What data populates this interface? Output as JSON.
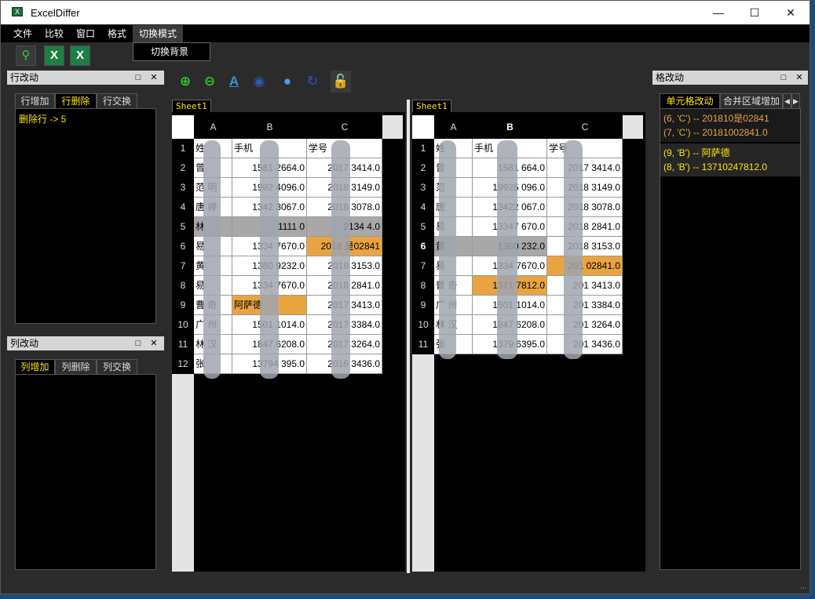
{
  "window": {
    "title": "ExcelDiffer"
  },
  "menu": {
    "items": [
      "文件",
      "比较",
      "窗口",
      "格式",
      "切换模式"
    ],
    "active": "切换模式",
    "dropdown_item": "切换背景"
  },
  "toolbar_main": [
    {
      "icon": "search-green-icon",
      "color": "#33cc33"
    },
    {
      "icon": "excel-file-icon",
      "color": "#1d7f44"
    },
    {
      "icon": "excel-file-icon",
      "color": "#1d7f44"
    }
  ],
  "toolbar_view": [
    {
      "icon": "zoom-in-icon",
      "color": "#2ecc2e"
    },
    {
      "icon": "zoom-out-icon",
      "color": "#2ecc2e"
    },
    {
      "icon": "font-color-icon",
      "color": "#3a8fe0"
    },
    {
      "icon": "fill-color-icon",
      "color": "#2a5ca8"
    },
    {
      "icon": "palette-icon",
      "color": "#4aa0e8"
    },
    {
      "icon": "refresh-icon",
      "color": "#2a4aa8"
    },
    {
      "icon": "unlock-icon",
      "color": "#f0a020"
    }
  ],
  "row_panel": {
    "title": "行改动",
    "tabs": [
      "行增加",
      "行删除",
      "行交换"
    ],
    "selected_tab": 1,
    "items": [
      "删除行 -> 5"
    ]
  },
  "col_panel": {
    "title": "列改动",
    "tabs": [
      "列增加",
      "列删除",
      "列交换"
    ],
    "selected_tab": 0,
    "items": []
  },
  "cell_panel": {
    "title": "格改动",
    "tabs": [
      "单元格改动",
      "合并区域增加"
    ],
    "selected_tab": 0,
    "groups": [
      {
        "color": "#e9a441",
        "items": [
          "(6, 'C') -- 201810是02841",
          "(7, 'C') -- 20181002841.0"
        ]
      },
      {
        "color": "#ffe600",
        "items": [
          "(9, 'B') -- 阿萨德",
          "(8, 'B') -- 13710247812.0"
        ]
      }
    ]
  },
  "left_sheet": {
    "tab": "Sheet1",
    "columns": [
      "A",
      "B",
      "C"
    ],
    "rows": [
      {
        "n": "1",
        "cells": [
          "姓",
          "手机",
          "学号"
        ],
        "styles": [
          "",
          "",
          ""
        ]
      },
      {
        "n": "2",
        "cells": [
          "曾",
          "1581 2664.0",
          "2017 3414.0"
        ],
        "styles": [
          "",
          "num",
          "num"
        ]
      },
      {
        "n": "3",
        "cells": [
          "范 明",
          "1992 4096.0",
          "2018 3149.0"
        ],
        "styles": [
          "",
          "num",
          "num"
        ]
      },
      {
        "n": "4",
        "cells": [
          "唐 婷",
          "1342 3067.0",
          "2018 3078.0"
        ],
        "styles": [
          "",
          "num",
          "num"
        ]
      },
      {
        "n": "5",
        "cells": [
          "林",
          "1111 0",
          "2134 4.0"
        ],
        "styles": [
          "gray",
          "gray",
          "gray"
        ]
      },
      {
        "n": "6",
        "cells": [
          "易",
          "1334 7670.0",
          "2018 是02841"
        ],
        "styles": [
          "",
          "num",
          "orange"
        ]
      },
      {
        "n": "7",
        "cells": [
          "黄",
          "1380 9232.0",
          "2018 3153.0"
        ],
        "styles": [
          "",
          "num",
          "num"
        ]
      },
      {
        "n": "8",
        "cells": [
          "易",
          "1334 7670.0",
          "2018 2841.0"
        ],
        "styles": [
          "",
          "num",
          "num"
        ]
      },
      {
        "n": "9",
        "cells": [
          "曹 奇",
          "阿萨德",
          "2017 3413.0"
        ],
        "styles": [
          "",
          "orange",
          "num"
        ]
      },
      {
        "n": "10",
        "cells": [
          "广 州",
          "1501 1014.0",
          "2017 3384.0"
        ],
        "styles": [
          "",
          "num",
          "num"
        ]
      },
      {
        "n": "11",
        "cells": [
          "林 汉",
          "1847 6208.0",
          "2017 3264.0"
        ],
        "styles": [
          "",
          "num",
          "num"
        ]
      },
      {
        "n": "12",
        "cells": [
          "张",
          "13794 395.0",
          "2016 3436.0"
        ],
        "styles": [
          "",
          "num",
          "num"
        ]
      }
    ]
  },
  "right_sheet": {
    "tab": "Sheet1",
    "columns": [
      "A",
      "B",
      "C"
    ],
    "rows": [
      {
        "n": "1",
        "cells": [
          "姓",
          "手机",
          "学号"
        ],
        "styles": [
          "",
          "",
          ""
        ]
      },
      {
        "n": "2",
        "cells": [
          "曾",
          "1581 664.0",
          "2017 3414.0"
        ],
        "styles": [
          "",
          "num",
          "num"
        ]
      },
      {
        "n": "3",
        "cells": [
          "范",
          "19925 096.0",
          "2018 3149.0"
        ],
        "styles": [
          "",
          "num",
          "num"
        ]
      },
      {
        "n": "4",
        "cells": [
          "唐",
          "13422 067.0",
          "2018 3078.0"
        ],
        "styles": [
          "",
          "num",
          "num"
        ]
      },
      {
        "n": "5",
        "cells": [
          "易",
          "13347 670.0",
          "2018 2841.0"
        ],
        "styles": [
          "",
          "num",
          "num"
        ]
      },
      {
        "n": "6",
        "cells": [
          "黄",
          "1380 232.0",
          "2018 3153.0"
        ],
        "styles": [
          "gray",
          "gray",
          "num"
        ]
      },
      {
        "n": "7",
        "cells": [
          "易",
          "1334 7670.0",
          "201 02841.0"
        ],
        "styles": [
          "",
          "num",
          "orange"
        ]
      },
      {
        "n": "8",
        "cells": [
          "曹 奇",
          "1371 7812.0",
          "201 3413.0"
        ],
        "styles": [
          "",
          "orange",
          "num"
        ]
      },
      {
        "n": "9",
        "cells": [
          "广 州",
          "1501 1014.0",
          "201 3384.0"
        ],
        "styles": [
          "",
          "num",
          "num"
        ]
      },
      {
        "n": "10",
        "cells": [
          "林 汉",
          "1847 6208.0",
          "201 3264.0"
        ],
        "styles": [
          "",
          "num",
          "num"
        ]
      },
      {
        "n": "11",
        "cells": [
          "张",
          "1379 6395.0",
          "201 3436.0"
        ],
        "styles": [
          "",
          "num",
          "num"
        ]
      }
    ]
  }
}
